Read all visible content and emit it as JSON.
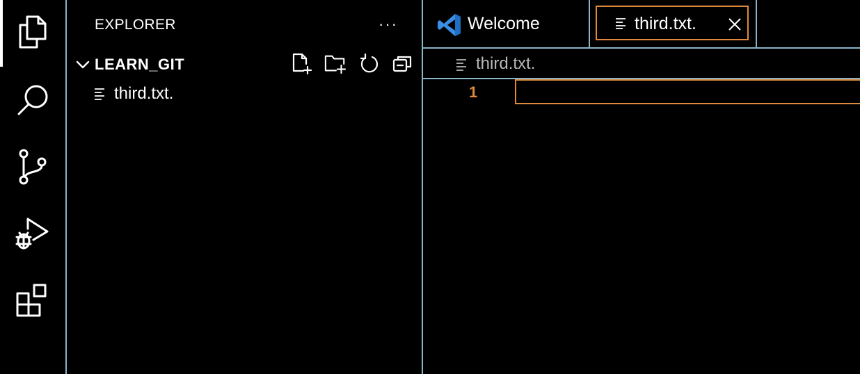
{
  "activity_bar": {
    "items": [
      {
        "icon": "files-icon",
        "active": true
      },
      {
        "icon": "search-icon"
      },
      {
        "icon": "source-control-icon"
      },
      {
        "icon": "run-debug-icon"
      },
      {
        "icon": "extensions-icon"
      }
    ]
  },
  "sidebar": {
    "title": "EXPLORER",
    "more": "···",
    "folder": {
      "label": "LEARN_GIT",
      "tools": [
        "new-file-icon",
        "new-folder-icon",
        "refresh-icon",
        "collapse-all-icon"
      ]
    },
    "files": [
      {
        "label": "third.txt."
      }
    ]
  },
  "editor": {
    "tabs": [
      {
        "label": "Welcome",
        "icon": "vscode-logo-icon"
      },
      {
        "label": "third.txt.",
        "icon": "text-file-icon",
        "active": true
      }
    ],
    "breadcrumb": "third.txt.",
    "line_numbers": [
      "1"
    ],
    "colors": {
      "accent": "#e08a3c",
      "border": "#8ab4c8",
      "background": "#000000"
    }
  }
}
